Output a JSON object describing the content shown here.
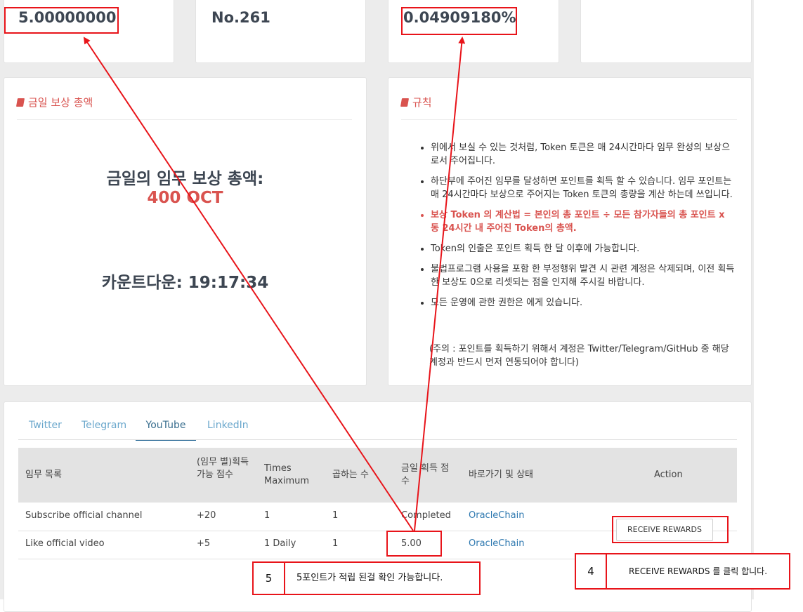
{
  "stats": {
    "points": "5.00000000",
    "rank": "No.261",
    "ratio": "0.04909180%"
  },
  "reward_panel": {
    "title": "금일 보상 총액",
    "heading": "금일의 임무 보상 총액:",
    "amount": "400 OCT",
    "countdown": "카운트다운: 19:17:34"
  },
  "rules_panel": {
    "title": "규칙",
    "items": [
      "위에서 보실 수 있는 것처럼, Token 토큰은 매 24시간마다 임무 완성의 보상으로서 주어집니다.",
      "하단부에 주어진 임무를 달성하면 포인트를 획득 할 수 있습니다. 임무 포인트는 매 24시간마다 보상으로 주어지는 Token 토큰의 총량을 계산 하는데 쓰입니다.",
      "보상 Token 의 계산법 = 본인의 총 포인트 ÷ 모든 참가자들의 총 포인트 x 동 24시간 내 주어진 Token의 총액.",
      "Token의 인출은 포인트 획득 한 달 이후에 가능합니다.",
      "불법프로그램 사용을 포함 한 부정행위 발견 시 관련 계정은 삭제되며, 이전 획득한 보상도 0으로 리셋되는 점을 인지해 주시길 바랍니다.",
      "모든 운영에 관한 권한은 에게 있습니다."
    ],
    "note": "(주의 : 포인트를 획득하기 위해서 계정은 Twitter/Telegram/GitHub 중 해당 계정과 반드시 먼저 연동되어야 합니다)"
  },
  "tabs": [
    "Twitter",
    "Telegram",
    "YouTube",
    "LinkedIn"
  ],
  "active_tab": "YouTube",
  "table": {
    "headers": [
      "임무 목록",
      "(임무 별)획득 가능 점수",
      "Times Maximum",
      "곱하는 수",
      "금일 획득 점수",
      "바로가기 및 상태",
      "Action"
    ],
    "rows": [
      {
        "task": "Subscribe official channel",
        "points": "+20",
        "times": "1",
        "multiplier": "1",
        "today": "Completed",
        "link": "OracleChain",
        "action": ""
      },
      {
        "task": "Like official video",
        "points": "+5",
        "times": "1 Daily",
        "multiplier": "1",
        "today": "5.00",
        "link": "OracleChain",
        "action": "RECEIVE REWARDS"
      }
    ]
  },
  "annotations": {
    "step5_number": "5",
    "step5_text": "5포인트가 적립 된걸 확인 가능합니다.",
    "step4_number": "4",
    "step4_text": "RECEIVE REWARDS 를 클릭 합니다.",
    "color": "#e8141a"
  }
}
